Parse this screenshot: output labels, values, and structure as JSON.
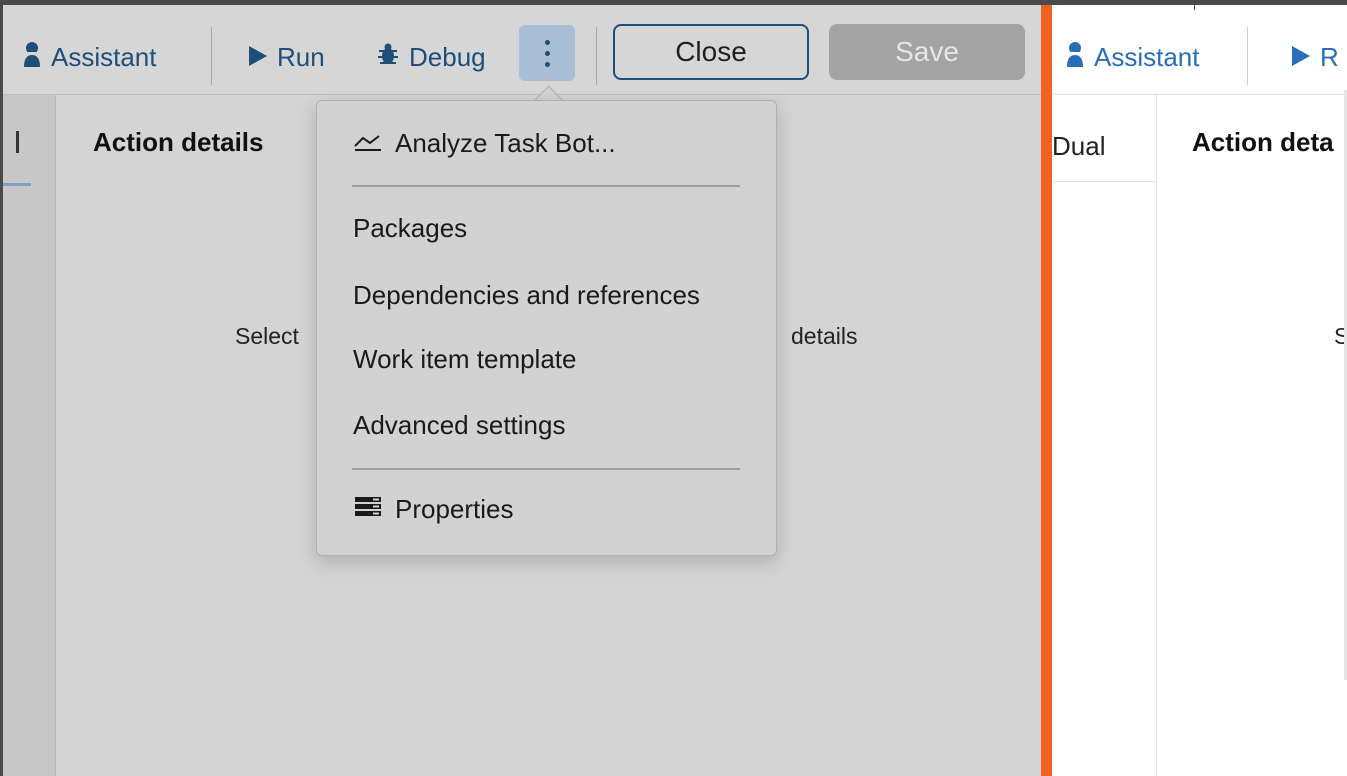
{
  "left_window": {
    "toolbar": {
      "assistant_label": "Assistant",
      "run_label": "Run",
      "debug_label": "Debug",
      "close_label": "Close",
      "save_label": "Save"
    },
    "panel": {
      "heading": "Action details",
      "placeholder_left": "Select",
      "placeholder_right": "details"
    }
  },
  "menu": {
    "items": [
      {
        "label": "Analyze Task Bot...",
        "icon": "chart-line-icon"
      },
      {
        "label": "Packages"
      },
      {
        "label": "Dependencies and references"
      },
      {
        "label": "Work item template"
      },
      {
        "label": "Advanced settings"
      },
      {
        "label": "Properties",
        "icon": "properties-icon"
      }
    ]
  },
  "right_window": {
    "toolbar": {
      "assistant_label": "Assistant",
      "run_label": "R"
    },
    "tab_label": "Dual",
    "heading": "Action deta",
    "placeholder": "S"
  },
  "colors": {
    "accent": "#1f4e79",
    "divider": "#f26322",
    "link": "#2a6ebb"
  }
}
